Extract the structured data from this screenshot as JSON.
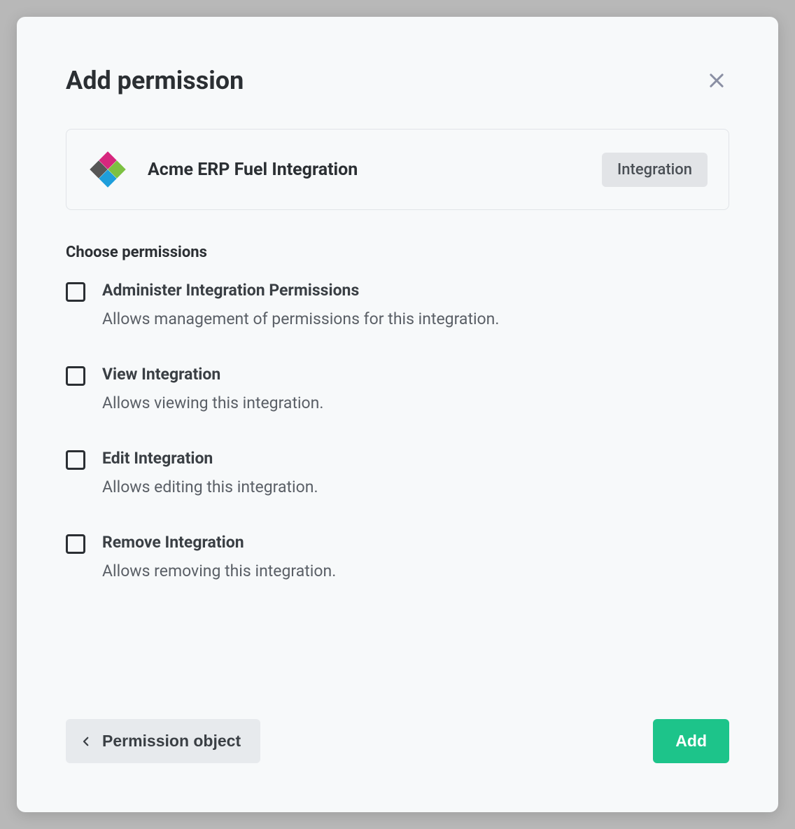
{
  "modal": {
    "title": "Add permission"
  },
  "object": {
    "name": "Acme ERP Fuel Integration",
    "type_label": "Integration"
  },
  "section": {
    "label": "Choose permissions"
  },
  "permissions": [
    {
      "title": "Administer Integration Permissions",
      "description": "Allows management of permissions for this integration."
    },
    {
      "title": "View Integration",
      "description": "Allows viewing this integration."
    },
    {
      "title": "Edit Integration",
      "description": "Allows editing this integration."
    },
    {
      "title": "Remove Integration",
      "description": "Allows removing this integration."
    }
  ],
  "footer": {
    "back_label": "Permission object",
    "submit_label": "Add"
  },
  "logo_colors": {
    "top": "#d6277e",
    "right": "#7cc142",
    "bottom": "#1e9edb",
    "left": "#565656"
  }
}
